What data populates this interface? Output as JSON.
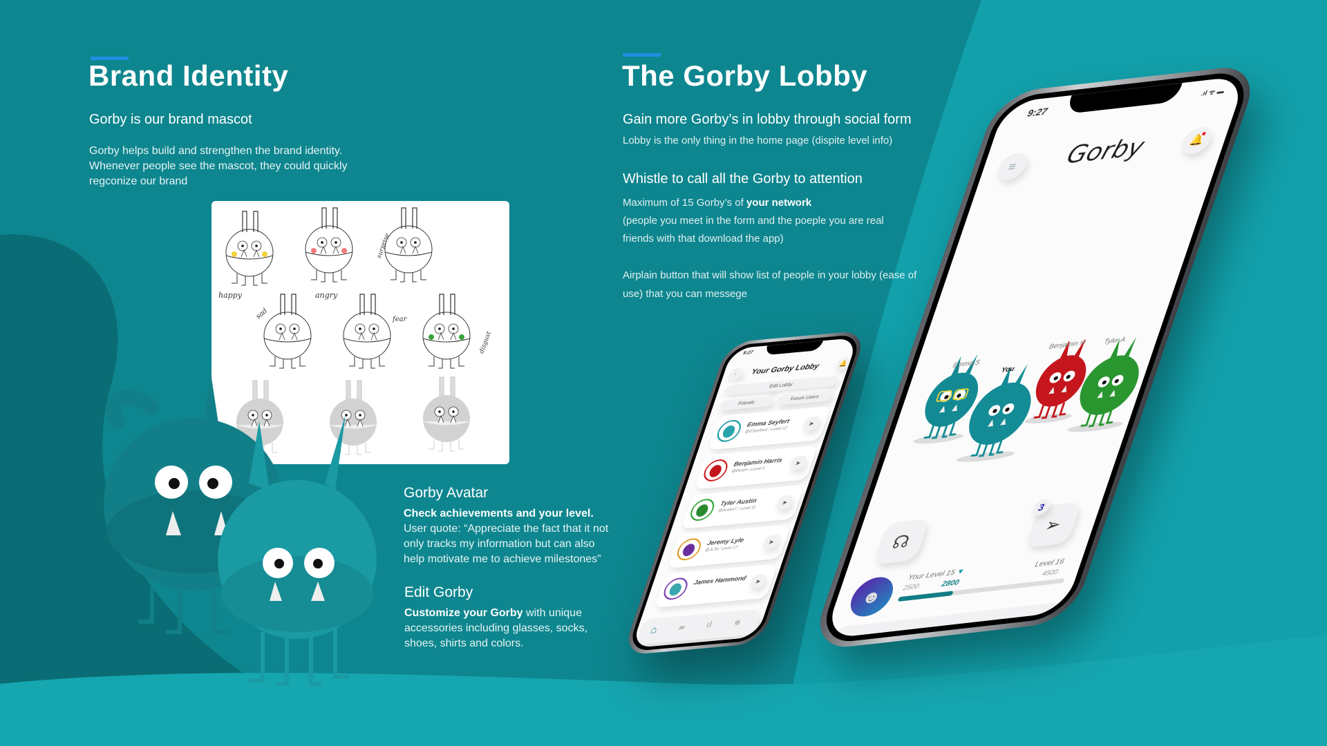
{
  "left": {
    "title": "Brand Identity",
    "subtitle": "Gorby is our brand mascot",
    "body": "Gorby helps build and strengthen the brand identity. Whenever people see the mascot, they could quickly regconize our brand",
    "sketch_labels": [
      "happy",
      "angry",
      "surprise",
      "sad",
      "fear",
      "disgust"
    ],
    "avatar": {
      "heading": "Gorby Avatar",
      "bold": "Check achievements and your level.",
      "text": " User quote: “Appreciate the fact that it not only tracks my information but can also help motivate me to achieve milestones”"
    },
    "edit": {
      "heading": "Edit Gorby",
      "bold": "Customize your Gorby",
      "text": " with unique accessories including glasses, socks, shoes, shirts and colors."
    }
  },
  "right": {
    "title": "The Gorby Lobby",
    "h1": "Gain more Gorby’s in lobby through social form",
    "p1": "Lobby is the only thing in the home page (dispite level info)",
    "h2": "Whistle to call all the Gorby to attention",
    "p2a": "Maximum of 15 Gorby’s of ",
    "p2b": "your network",
    "p2c": "(people you meet in the form and the poeple you are real friends with that download the app)",
    "p3": "Airplain button that will show list of people in your lobby (ease of use) that you can messege"
  },
  "big_phone": {
    "time": "9:27",
    "app_title": "Gorby",
    "characters": [
      {
        "name": "Emma S",
        "color": "#138a93"
      },
      {
        "name": "You",
        "color": "#148c96"
      },
      {
        "name": "Benjamin H",
        "color": "#c4161c"
      },
      {
        "name": "Tyler A",
        "color": "#2a9630"
      }
    ],
    "message_badge": "3",
    "level": {
      "current_label": "Your Level 15",
      "min": "2500",
      "value": "2800",
      "next_label": "Level 16",
      "max": "4500",
      "progress_fraction": 0.33
    },
    "accent": "#127e86"
  },
  "small_phone": {
    "time": "9:27",
    "title": "Your Gorby Lobby",
    "edit_label": "Edit Lobby",
    "tab_friends": "Friends",
    "tab_forum": "Forum Users",
    "users": [
      {
        "name": "Emma Seyfert",
        "handle": "@ESeyfert1 / Level 12",
        "ring": "#1a9aa3",
        "body": "#2aa3ab"
      },
      {
        "name": "Benjamin Harris",
        "handle": "@BenjH / Level 5",
        "ring": "#d0191f",
        "body": "#c4161c"
      },
      {
        "name": "Tyler Austin",
        "handle": "@AustinT / Level 11",
        "ring": "#30a636",
        "body": "#2a8a30"
      },
      {
        "name": "Jeremy Lyle",
        "handle": "@JL34 / Level 17",
        "ring": "#e09a24",
        "body": "#6a2f9e"
      },
      {
        "name": "James Hammond",
        "handle": "",
        "ring": "#7a3fb0",
        "body": "#3aa7ae"
      }
    ]
  }
}
